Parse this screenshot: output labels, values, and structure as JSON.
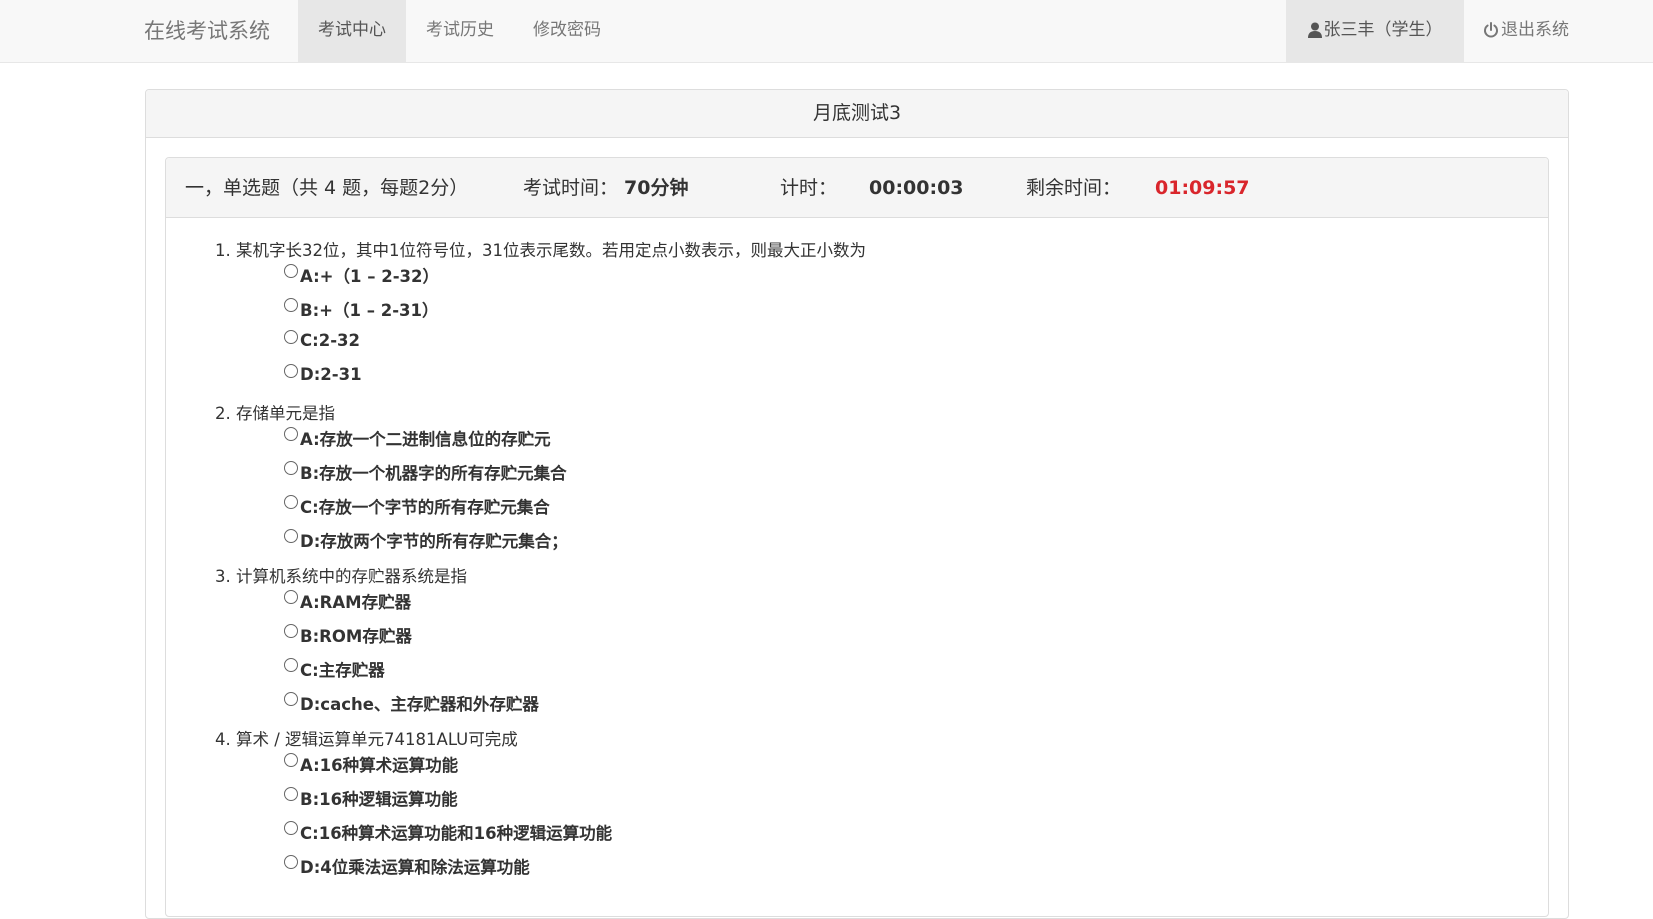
{
  "navbar": {
    "brand": "在线考试系统",
    "items": [
      {
        "label": "考试中心"
      },
      {
        "label": "考试历史"
      },
      {
        "label": "修改密码"
      }
    ],
    "user": "张三丰（学生）",
    "logout": "退出系统"
  },
  "exam": {
    "title": "月底测试3",
    "section": "一，单选题（共 4 题，每题2分）",
    "time_label": "考试时间：",
    "time_value": "70分钟",
    "timer_label": "计时：",
    "timer_value": "00:00:03",
    "remain_label": "剩余时间：",
    "remain_value": "01:09:57",
    "remain_color": "#d9262c"
  },
  "questions": [
    {
      "title": "1. 某机字长32位，其中1位符号位，31位表示尾数。若用定点小数表示，则最大正小数为",
      "options": [
        "A:+（1 – 2-32）",
        "B:+（1 – 2-31）",
        "C:2-32",
        "D:2-31"
      ]
    },
    {
      "title": "2. 存储单元是指",
      "options": [
        "A:存放一个二进制信息位的存贮元",
        "B:存放一个机器字的所有存贮元集合",
        "C:存放一个字节的所有存贮元集合",
        "D:存放两个字节的所有存贮元集合；"
      ]
    },
    {
      "title": "3. 计算机系统中的存贮器系统是指",
      "options": [
        "A:RAM存贮器",
        "B:ROM存贮器",
        "C:主存贮器",
        "D:cache、主存贮器和外存贮器"
      ]
    },
    {
      "title": "4. 算术 / 逻辑运算单元74181ALU可完成",
      "options": [
        "A:16种算术运算功能",
        "B:16种逻辑运算功能",
        "C:16种算术运算功能和16种逻辑运算功能",
        "D:4位乘法运算和除法运算功能"
      ]
    }
  ]
}
